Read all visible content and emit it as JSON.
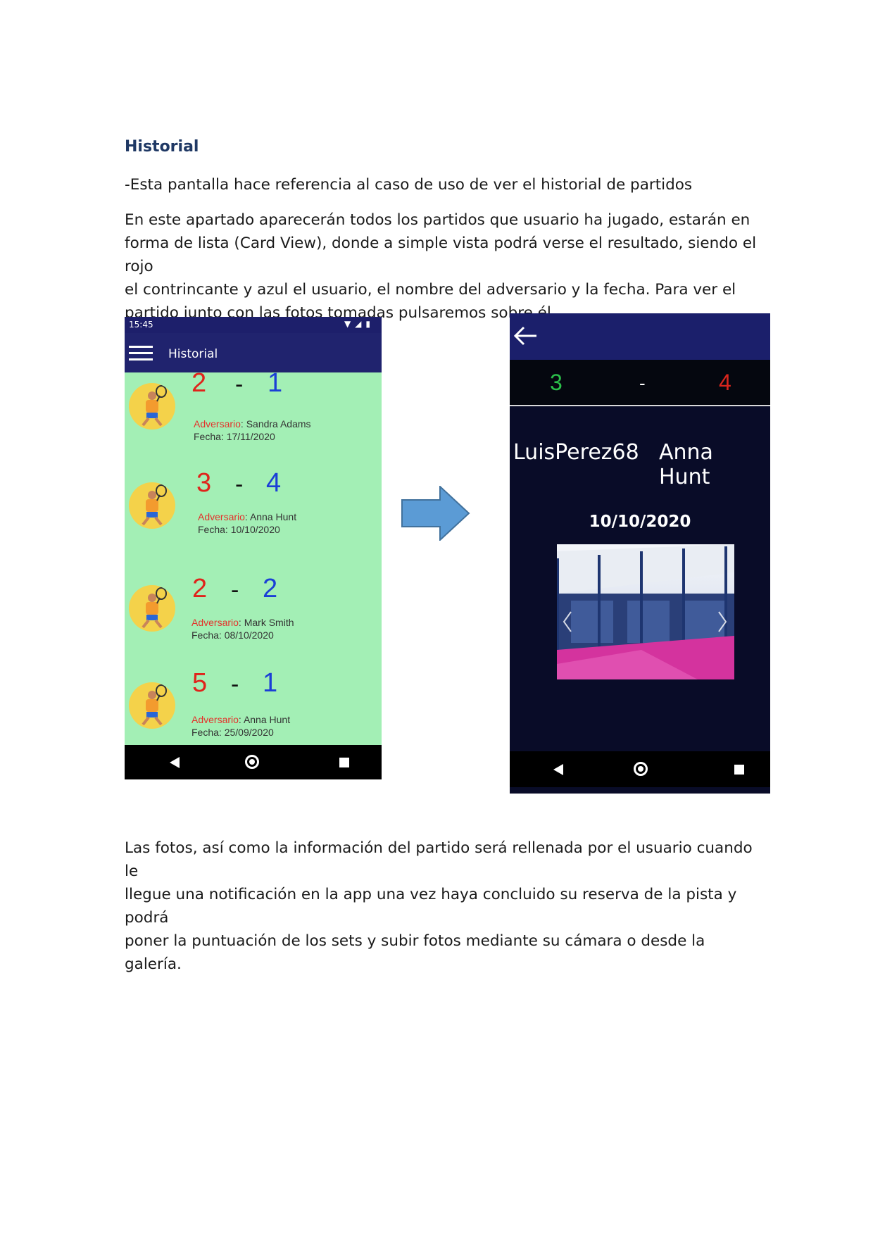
{
  "doc": {
    "heading": "Historial",
    "line1": "-Esta pantalla hace referencia al caso de uso de ver el historial de partidos",
    "paragraph2_lines": [
      "En este apartado aparecerán todos los partidos que usuario ha jugado, estarán en",
      "forma de lista (Card View), donde a simple vista podrá verse el resultado, siendo el rojo",
      "el contrincante y azul el usuario, el nombre del adversario y la fecha. Para ver el",
      "partido junto con las fotos tomadas pulsaremos sobre él."
    ],
    "paragraph3_lines": [
      "Las fotos, así como la información del partido será rellenada por el usuario cuando le",
      "llegue una notificación en la app una vez haya concluido su reserva de la pista y podrá",
      "poner la puntuación de los sets y subir fotos mediante su cámara o desde la galería."
    ]
  },
  "phone1": {
    "status_time": "15:45",
    "status_icons": "▼◢▮",
    "app_title": "Historial",
    "matches": [
      {
        "score_opponent": "2",
        "dash": "-",
        "score_user": "1",
        "adv_label": "Adversario",
        "adv_sep": ": ",
        "adv_name": "Sandra Adams",
        "date_label": "Fecha: ",
        "date": "17/11/2020"
      },
      {
        "score_opponent": "3",
        "dash": "-",
        "score_user": "4",
        "adv_label": "Adversario",
        "adv_sep": ": ",
        "adv_name": "Anna Hunt",
        "date_label": "Fecha: ",
        "date": "10/10/2020"
      },
      {
        "score_opponent": "2",
        "dash": "-",
        "score_user": "2",
        "adv_label": "Adversario",
        "adv_sep": ": ",
        "adv_name": "Mark Smith",
        "date_label": "Fecha: ",
        "date": "08/10/2020"
      },
      {
        "score_opponent": "5",
        "dash": "-",
        "score_user": "1",
        "adv_label": "Adversario",
        "adv_sep": ": ",
        "adv_name": "Anna Hunt",
        "date_label": "Fecha: ",
        "date": "25/09/2020"
      }
    ]
  },
  "phone2": {
    "score_user": "3",
    "dash": "-",
    "score_opponent": "4",
    "player_user": "LuisPerez68",
    "player_opponent": "Anna Hunt",
    "date": "10/10/2020"
  },
  "colors": {
    "list_bg": "#a3efb5",
    "appbar": "#20236e",
    "opponent_red": "#e0231b",
    "user_blue": "#1b3fd6",
    "detail_bg": "#090c28",
    "arrow_blue": "#5b9bd5"
  },
  "icons": {
    "menu": "hamburger-icon",
    "back": "back-arrow-icon",
    "nav_back": "triangle-back-icon",
    "nav_home": "circle-home-icon",
    "nav_recent": "square-recents-icon"
  }
}
